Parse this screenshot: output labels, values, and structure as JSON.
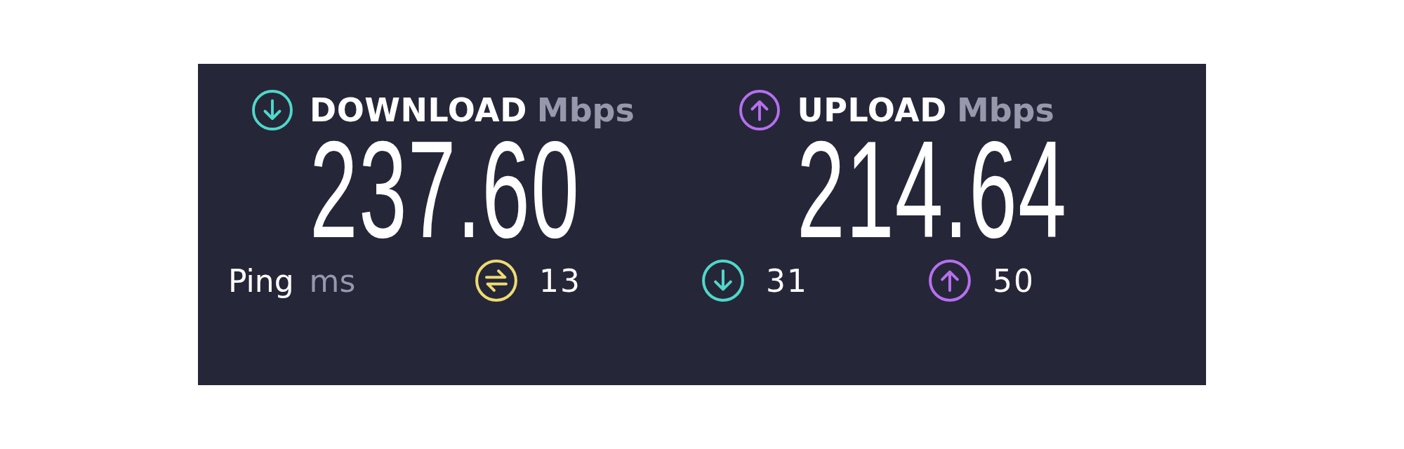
{
  "speeds": [
    {
      "kind": "download",
      "label": "DOWNLOAD",
      "unit": "Mbps",
      "value": "237.60"
    },
    {
      "kind": "upload",
      "label": "UPLOAD",
      "unit": "Mbps",
      "value": "214.64"
    }
  ],
  "ping": {
    "label": "Ping",
    "unit": "ms",
    "readings": [
      {
        "kind": "idle",
        "value": "13"
      },
      {
        "kind": "download",
        "value": "31"
      },
      {
        "kind": "upload",
        "value": "50"
      }
    ]
  }
}
